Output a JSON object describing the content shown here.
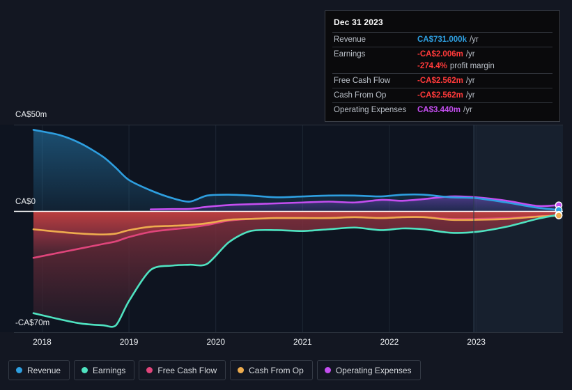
{
  "colors": {
    "background": "#131722",
    "plot_background": "#0e1420",
    "forecast_band": "#17202e",
    "revenue": "#2e9fe0",
    "earnings": "#4fe3c1",
    "free_cash_flow": "#e0457b",
    "cash_from_op": "#eeac4e",
    "operating_expenses": "#c44ef0",
    "negative_fill": "#b0383c",
    "axis_text": "#e9ecef",
    "gridline": "#2b323d",
    "zero_line": "#ffffff",
    "tooltip_bg": "#0a0a0c",
    "tooltip_border": "#3c4048",
    "tooltip_key": "#b9bfc7",
    "value_negative": "#ff3a3a"
  },
  "tooltip": {
    "title": "Dec 31 2023",
    "rows": [
      {
        "key": "Revenue",
        "value": "CA$731.000k",
        "suffix": "/yr",
        "color": "#2e9fe0"
      },
      {
        "key": "Earnings",
        "value": "-CA$2.006m",
        "suffix": "/yr",
        "color": "#ff3a3a"
      },
      {
        "key": "",
        "value": "-274.4%",
        "suffix": "profit margin",
        "color": "#ff3a3a"
      },
      {
        "key": "Free Cash Flow",
        "value": "-CA$2.562m",
        "suffix": "/yr",
        "color": "#ff3a3a"
      },
      {
        "key": "Cash From Op",
        "value": "-CA$2.562m",
        "suffix": "/yr",
        "color": "#ff3a3a"
      },
      {
        "key": "Operating Expenses",
        "value": "CA$3.440m",
        "suffix": "/yr",
        "color": "#c44ef0"
      }
    ]
  },
  "legend": {
    "items": [
      {
        "label": "Revenue",
        "color": "#2e9fe0"
      },
      {
        "label": "Earnings",
        "color": "#4fe3c1"
      },
      {
        "label": "Free Cash Flow",
        "color": "#e0457b"
      },
      {
        "label": "Cash From Op",
        "color": "#eeac4e"
      },
      {
        "label": "Operating Expenses",
        "color": "#c44ef0"
      }
    ]
  },
  "axes": {
    "y_ticks": [
      {
        "label": "CA$50m",
        "value": 50
      },
      {
        "label": "CA$0",
        "value": 0
      },
      {
        "label": "-CA$70m",
        "value": -70
      }
    ],
    "x_ticks": [
      {
        "label": "2018",
        "value": 2018
      },
      {
        "label": "2019",
        "value": 2019
      },
      {
        "label": "2020",
        "value": 2020
      },
      {
        "label": "2021",
        "value": 2021
      },
      {
        "label": "2022",
        "value": 2022
      },
      {
        "label": "2023",
        "value": 2023
      }
    ]
  },
  "chart_data": {
    "type": "area",
    "title": "",
    "xlabel": "",
    "ylabel": "CA$",
    "currency": "CA$",
    "unit": "millions",
    "xlim": [
      2017.9,
      2023.95
    ],
    "ylim": [
      -70,
      50
    ],
    "grid": true,
    "legend_position": "bottom",
    "forecast_start": 2023.0,
    "x": [
      2017.9,
      2018.2,
      2018.45,
      2018.7,
      2018.85,
      2019.0,
      2019.25,
      2019.5,
      2019.7,
      2019.9,
      2020.15,
      2020.4,
      2020.7,
      2021.0,
      2021.3,
      2021.6,
      2021.9,
      2022.15,
      2022.4,
      2022.7,
      2023.0,
      2023.35,
      2023.7,
      2023.95
    ],
    "series": [
      {
        "name": "Revenue",
        "color": "#2e9fe0",
        "values": [
          47.0,
          44.0,
          39.0,
          31.5,
          25.0,
          18.0,
          12.0,
          7.5,
          5.5,
          9.0,
          9.5,
          9.0,
          8.0,
          8.5,
          9.0,
          9.0,
          8.5,
          9.5,
          9.5,
          8.0,
          7.5,
          5.0,
          2.0,
          0.731
        ]
      },
      {
        "name": "Earnings",
        "color": "#4fe3c1",
        "values": [
          -59.0,
          -62.5,
          -65.0,
          -66.0,
          -66.0,
          -52.0,
          -34.0,
          -31.5,
          -31.0,
          -30.5,
          -18.0,
          -11.5,
          -11.0,
          -11.5,
          -10.5,
          -9.5,
          -11.0,
          -10.0,
          -10.5,
          -12.5,
          -12.0,
          -9.0,
          -4.5,
          -2.006
        ]
      },
      {
        "name": "Free Cash Flow",
        "color": "#e0457b",
        "values": [
          -27.0,
          -24.0,
          -21.5,
          -19.0,
          -17.5,
          -15.0,
          -12.0,
          -10.5,
          -9.5,
          -8.0,
          -5.5,
          -4.5,
          -4.0,
          -4.0,
          -4.0,
          -3.5,
          -4.0,
          -3.5,
          -3.5,
          -4.5,
          -4.5,
          -4.0,
          -3.0,
          -2.562
        ]
      },
      {
        "name": "Cash From Op",
        "color": "#eeac4e",
        "values": [
          -10.5,
          -12.0,
          -13.0,
          -13.5,
          -13.0,
          -11.0,
          -9.0,
          -8.5,
          -8.0,
          -7.0,
          -5.0,
          -4.5,
          -4.0,
          -4.0,
          -4.0,
          -3.5,
          -4.0,
          -3.5,
          -3.5,
          -5.0,
          -5.0,
          -4.5,
          -3.2,
          -2.562
        ]
      },
      {
        "name": "Operating Expenses",
        "color": "#c44ef0",
        "values": [
          null,
          null,
          null,
          null,
          null,
          null,
          1.0,
          1.2,
          1.3,
          2.5,
          3.5,
          4.0,
          4.5,
          5.0,
          5.5,
          5.0,
          6.5,
          6.0,
          7.0,
          8.5,
          8.0,
          6.0,
          3.0,
          3.44
        ]
      }
    ]
  }
}
